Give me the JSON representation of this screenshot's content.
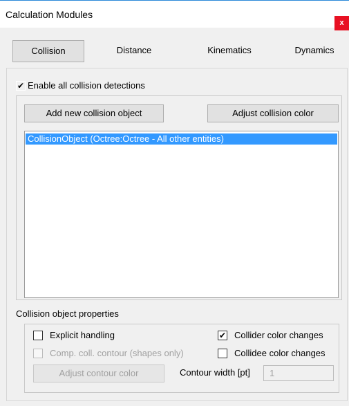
{
  "window": {
    "title": "Calculation Modules",
    "close_label": "x"
  },
  "tabs": [
    {
      "label": "Collision",
      "active": true
    },
    {
      "label": "Distance",
      "active": false
    },
    {
      "label": "Kinematics",
      "active": false
    },
    {
      "label": "Dynamics",
      "active": false
    }
  ],
  "collision": {
    "enable_all": {
      "label": "Enable all collision detections",
      "checked": true
    },
    "add_object_label": "Add new collision object",
    "adjust_color_label": "Adjust collision color",
    "objects": [
      {
        "label": "CollisionObject (Octree:Octree - All other entities)",
        "selected": true
      }
    ]
  },
  "properties": {
    "group_label": "Collision object properties",
    "explicit_handling": {
      "label": "Explicit handling",
      "checked": false
    },
    "comp_contour": {
      "label": "Comp. coll. contour (shapes only)",
      "checked": false,
      "enabled": false
    },
    "collider_color": {
      "label": "Collider color changes",
      "checked": true
    },
    "collidee_color": {
      "label": "Collidee color changes",
      "checked": false
    },
    "adjust_contour_label": "Adjust contour color",
    "contour_width_label": "Contour width [pt]",
    "contour_width_value": "1"
  },
  "check_mark": "✔",
  "colors": {
    "selection": "#3399ff",
    "close_button": "#e81123",
    "titlebar_accent": "#2b88d8"
  }
}
